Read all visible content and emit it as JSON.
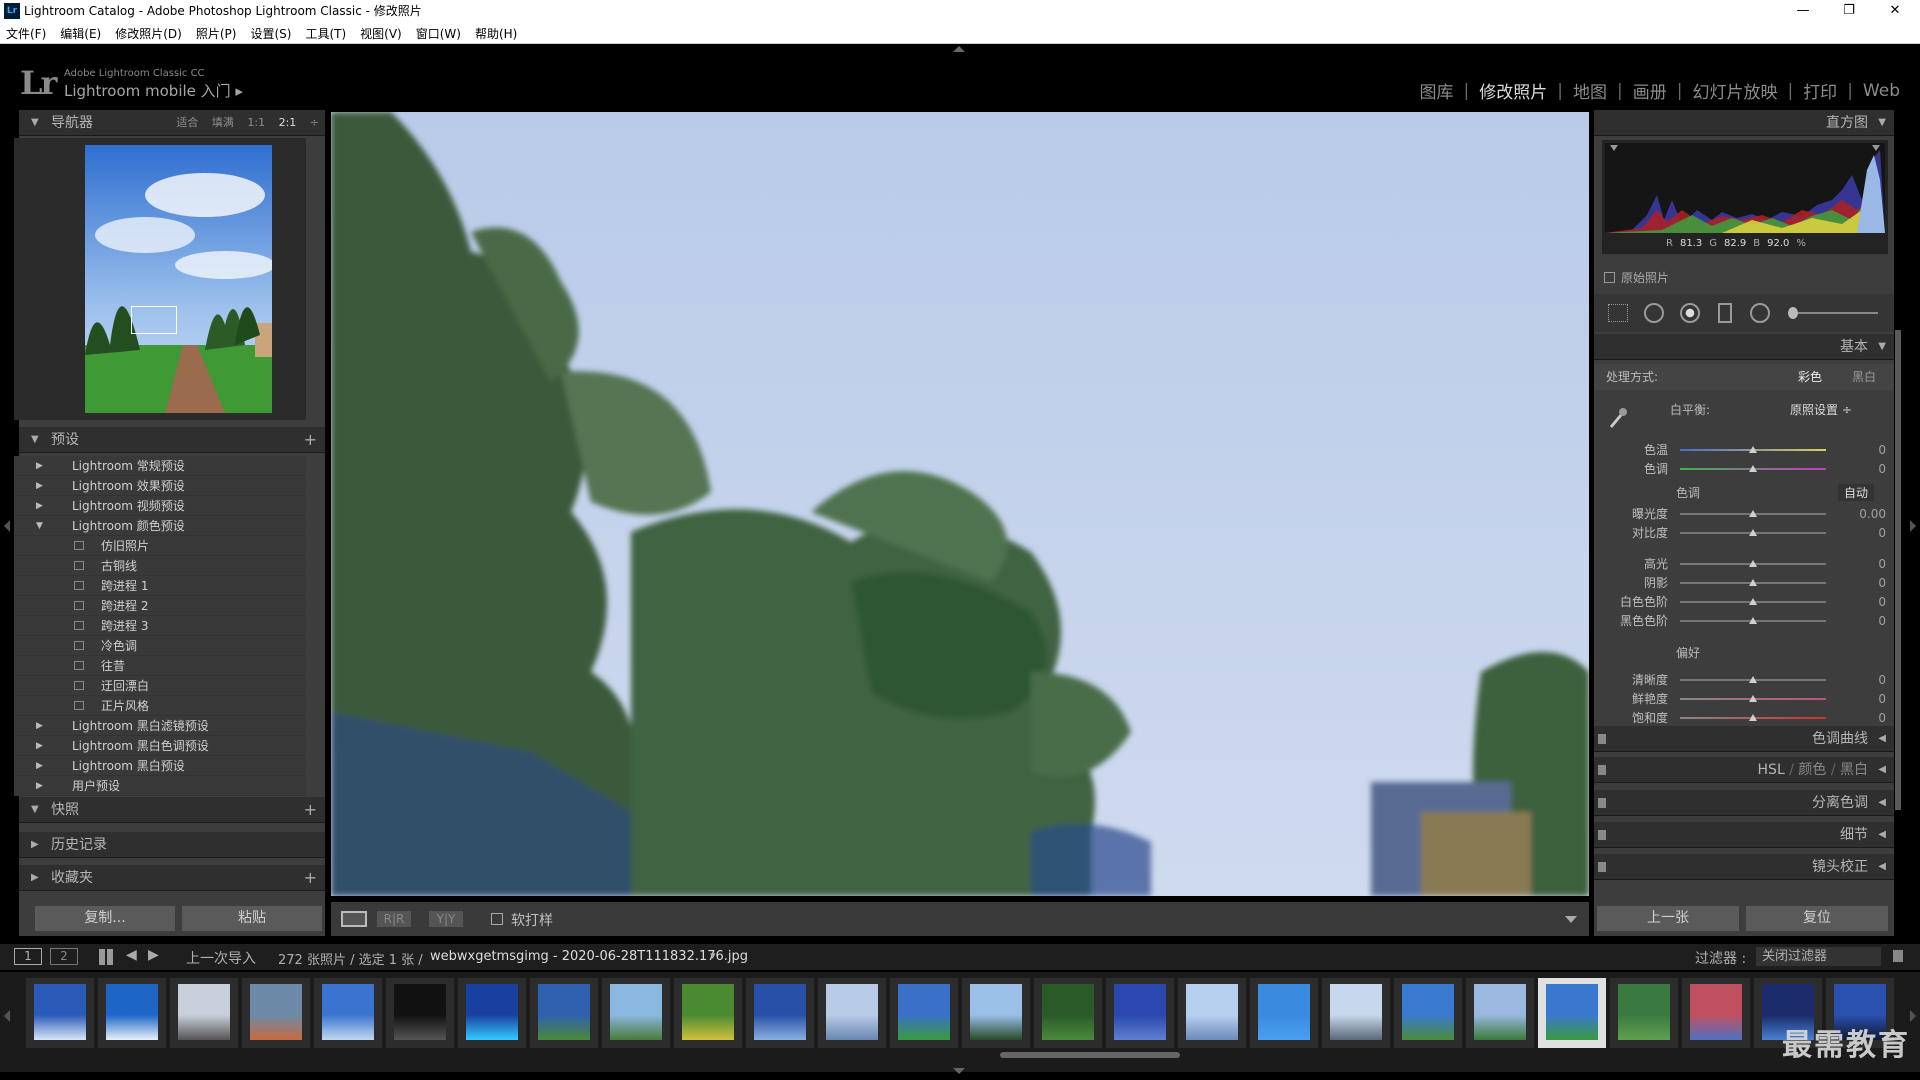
{
  "window": {
    "title": "Lightroom Catalog - Adobe Photoshop Lightroom Classic - 修改照片",
    "app_icon": "Lr",
    "minimize": "—",
    "restore": "❐",
    "close": "✕"
  },
  "menu": [
    "文件(F)",
    "编辑(E)",
    "修改照片(D)",
    "照片(P)",
    "设置(S)",
    "工具(T)",
    "视图(V)",
    "窗口(W)",
    "帮助(H)"
  ],
  "identity": {
    "logo": "Lr",
    "product": "Adobe Lightroom Classic CC",
    "mobile": "Lightroom mobile 入门 ▸"
  },
  "modules": {
    "items": [
      "图库",
      "修改照片",
      "地图",
      "画册",
      "幻灯片放映",
      "打印",
      "Web"
    ],
    "active": "修改照片",
    "separator": "|"
  },
  "left": {
    "navigator": {
      "title": "导航器",
      "opt_fit": "适合",
      "opt_fill": "填满",
      "opt_11": "1:1",
      "opt_21": "2:1",
      "opt_menu": "÷"
    },
    "presets": {
      "title": "预设",
      "items": [
        {
          "label": "Lightroom 常规预设",
          "expanded": false
        },
        {
          "label": "Lightroom 效果预设",
          "expanded": false
        },
        {
          "label": "Lightroom 视频预设",
          "expanded": false
        },
        {
          "label": "Lightroom 颜色预设",
          "expanded": true
        },
        {
          "label": "仿旧照片",
          "child": true
        },
        {
          "label": "古铜线",
          "child": true
        },
        {
          "label": "跨进程 1",
          "child": true
        },
        {
          "label": "跨进程 2",
          "child": true
        },
        {
          "label": "跨进程 3",
          "child": true
        },
        {
          "label": "冷色调",
          "child": true
        },
        {
          "label": "往昔",
          "child": true
        },
        {
          "label": "迂回漂白",
          "child": true
        },
        {
          "label": "正片风格",
          "child": true
        },
        {
          "label": "Lightroom 黑白滤镜预设",
          "expanded": false
        },
        {
          "label": "Lightroom 黑白色调预设",
          "expanded": false
        },
        {
          "label": "Lightroom 黑白预设",
          "expanded": false
        },
        {
          "label": "用户预设",
          "expanded": false
        }
      ]
    },
    "snapshots": {
      "title": "快照"
    },
    "history": {
      "title": "历史记录"
    },
    "collections": {
      "title": "收藏夹"
    },
    "copy_label": "复制...",
    "paste_label": "粘贴"
  },
  "toolbar": {
    "softproof_label": "软打样"
  },
  "right": {
    "histogram": {
      "title": "直方图",
      "r_label": "R",
      "r": "81.3",
      "g_label": "G",
      "g": "82.9",
      "b_label": "B",
      "b": "92.0",
      "pct": "%",
      "original_label": "原始照片"
    },
    "basic": {
      "title": "基本",
      "treatment_label": "处理方式:",
      "color": "彩色",
      "bw": "黑白",
      "wb_label": "白平衡:",
      "wb_value": "原照设置 ÷",
      "tone_label": "色调",
      "auto_label": "自动",
      "presence_label": "偏好",
      "sliders": [
        {
          "label": "色温",
          "value": "0",
          "pos": 0.5
        },
        {
          "label": "色调",
          "value": "0",
          "pos": 0.5
        },
        {
          "label": "曝光度",
          "value": "0.00",
          "pos": 0.5
        },
        {
          "label": "对比度",
          "value": "0",
          "pos": 0.5
        },
        {
          "label": "高光",
          "value": "0",
          "pos": 0.5
        },
        {
          "label": "阴影",
          "value": "0",
          "pos": 0.5
        },
        {
          "label": "白色色阶",
          "value": "0",
          "pos": 0.5
        },
        {
          "label": "黑色色阶",
          "value": "0",
          "pos": 0.5
        },
        {
          "label": "清晰度",
          "value": "0",
          "pos": 0.5
        },
        {
          "label": "鲜艳度",
          "value": "0",
          "pos": 0.5
        },
        {
          "label": "饱和度",
          "value": "0",
          "pos": 0.5
        }
      ]
    },
    "tone_curve": {
      "title": "色调曲线"
    },
    "hsl": {
      "hsl": "HSL",
      "sep": "/",
      "color": "颜色",
      "bw": "黑白"
    },
    "split_toning": {
      "title": "分离色调"
    },
    "detail": {
      "title": "细节"
    },
    "lens": {
      "title": "镜头校正"
    },
    "prev_label": "上一张",
    "reset_label": "复位"
  },
  "filmstrip_bar": {
    "screen1": "1",
    "screen2": "2",
    "source": "上一次导入",
    "count": "272 张照片 / 选定 1 张 /",
    "filename": "webwxgetmsgimg - 2020-06-28T111832.176.jpg",
    "filename_arrow": "▾",
    "filter_label": "过滤器 :",
    "filter_value": "关闭过滤器"
  },
  "filmstrip": {
    "thumb_count": 26,
    "selected_index": 21
  },
  "watermark": "最需教育",
  "colors": {
    "sky": "#c7d6ee",
    "panel": "#3d3d3d",
    "header": "#2f2f2f",
    "active": "#dcdcdc"
  }
}
